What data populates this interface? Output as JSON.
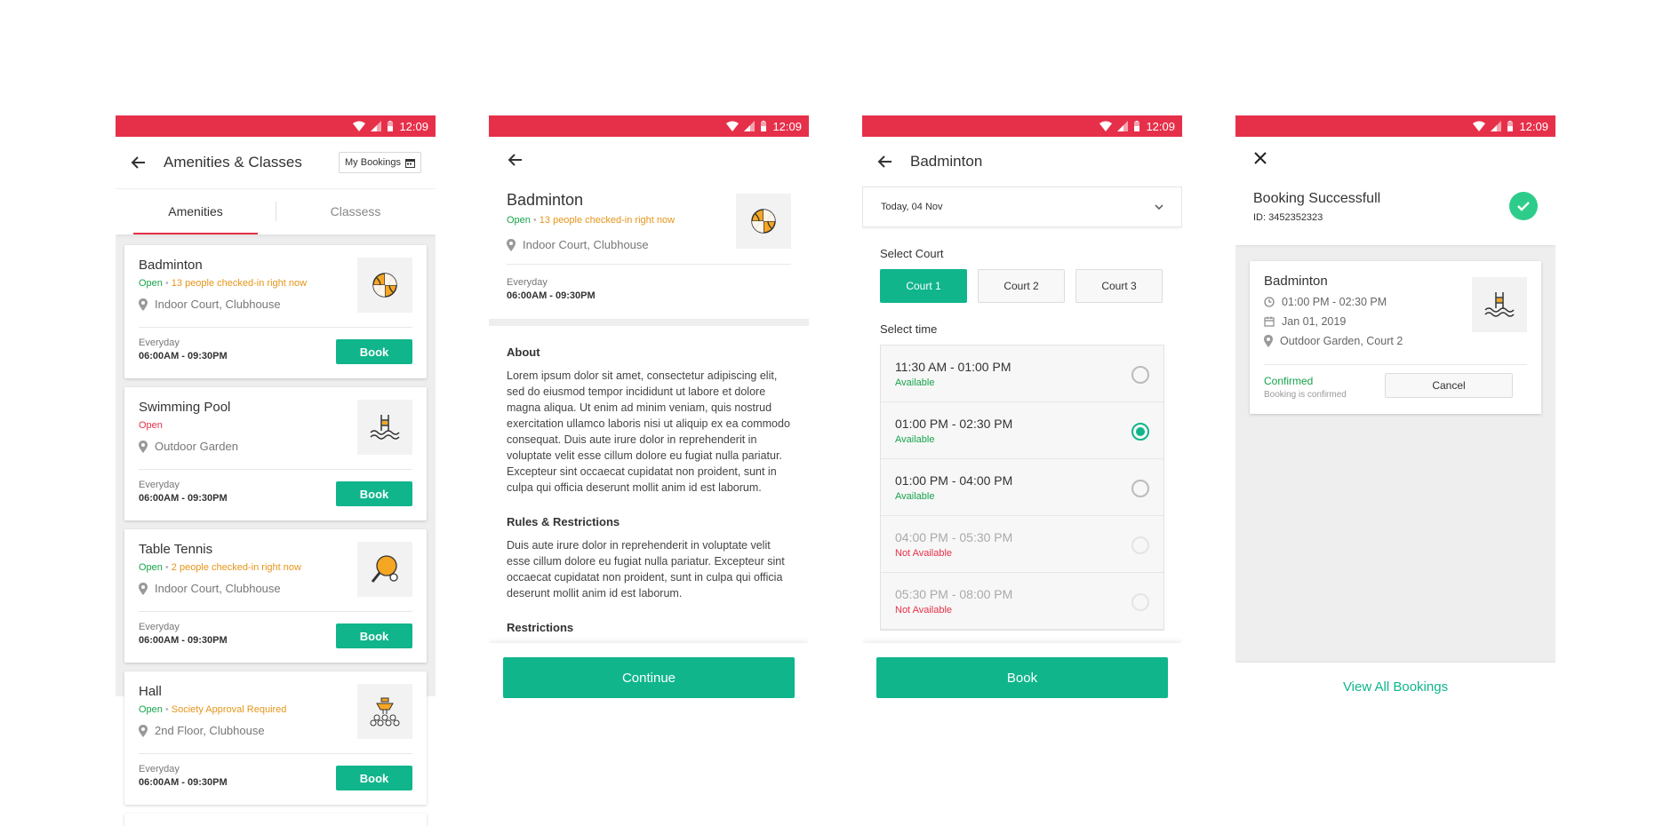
{
  "status_time": "12:09",
  "colors": {
    "brand_red": "#e6304a",
    "accent_green": "#10b58c",
    "warning_orange": "#e6951a"
  },
  "screen1": {
    "title": "Amenities & Classes",
    "my_bookings_label": "My Bookings",
    "tabs": [
      "Amenities",
      "Classess"
    ],
    "cards": [
      {
        "name": "Badminton",
        "status": "Open",
        "note": "13 people checked-in right now",
        "location": "Indoor Court, Clubhouse",
        "hours_label": "Everyday",
        "hours": "06:00AM - 09:30PM",
        "book": "Book",
        "icon": "basketball-icon"
      },
      {
        "name": "Swimming Pool",
        "status": "Open",
        "note": "",
        "location": "Outdoor Garden",
        "hours_label": "Everyday",
        "hours": "06:00AM - 09:30PM",
        "book": "Book",
        "icon": "swimming-pool-icon"
      },
      {
        "name": "Table Tennis",
        "status": "Open",
        "note": "2 people checked-in right now",
        "location": "Indoor Court, Clubhouse",
        "hours_label": "Everyday",
        "hours": "06:00AM - 09:30PM",
        "book": "Book",
        "icon": "table-tennis-icon"
      },
      {
        "name": "Hall",
        "status": "Open",
        "note": "Society Approval Required",
        "location": "2nd Floor, Clubhouse",
        "hours_label": "Everyday",
        "hours": "06:00AM - 09:30PM",
        "book": "Book",
        "icon": "hall-icon"
      }
    ]
  },
  "screen2": {
    "title": "Badminton",
    "status": "Open",
    "note": "13 people checked-in right now",
    "location": "Indoor Court, Clubhouse",
    "hours_label": "Everyday",
    "hours": "06:00AM - 09:30PM",
    "about_title": "About",
    "about_text": "Lorem ipsum dolor sit amet, consectetur adipiscing elit, sed do eiusmod tempor incididunt ut labore et dolore magna aliqua. Ut enim ad minim veniam, quis nostrud exercitation ullamco laboris nisi ut aliquip ex ea commodo consequat. Duis aute irure dolor in reprehenderit in voluptate velit esse cillum dolore eu fugiat nulla pariatur. Excepteur sint occaecat cupidatat non proident, sunt in culpa qui officia deserunt mollit anim id est laborum.",
    "rules_title": "Rules & Restrictions",
    "rules_text": "Duis aute irure dolor in reprehenderit in voluptate velit esse cillum dolore eu fugiat nulla pariatur. Excepteur sint occaecat cupidatat non proident, sunt in culpa qui officia deserunt mollit anim id est laborum.",
    "restrictions_title": "Restrictions",
    "continue": "Continue"
  },
  "screen3": {
    "title": "Badminton",
    "date": "Today, 04 Nov",
    "select_court": "Select Court",
    "courts": [
      "Court 1",
      "Court 2",
      "Court 3"
    ],
    "select_time": "Select time",
    "slots": [
      {
        "time": "11:30 AM - 01:00 PM",
        "availability": "Available"
      },
      {
        "time": "01:00 PM - 02:30 PM",
        "availability": "Available"
      },
      {
        "time": "01:00 PM - 04:00 PM",
        "availability": "Available"
      },
      {
        "time": "04:00 PM - 05:30 PM",
        "availability": "Not Available"
      },
      {
        "time": "05:30 PM - 08:00 PM",
        "availability": "Not Available"
      }
    ],
    "book": "Book"
  },
  "screen4": {
    "title": "Booking Successfull",
    "booking_id": "ID: 3452352323",
    "amenity": "Badminton",
    "time": "01:00 PM - 02:30 PM",
    "date": "Jan 01, 2019",
    "location": "Outdoor Garden, Court 2",
    "status": "Confirmed",
    "status_note": "Booking is confirmed",
    "cancel": "Cancel",
    "view_all": "View All Bookings"
  }
}
